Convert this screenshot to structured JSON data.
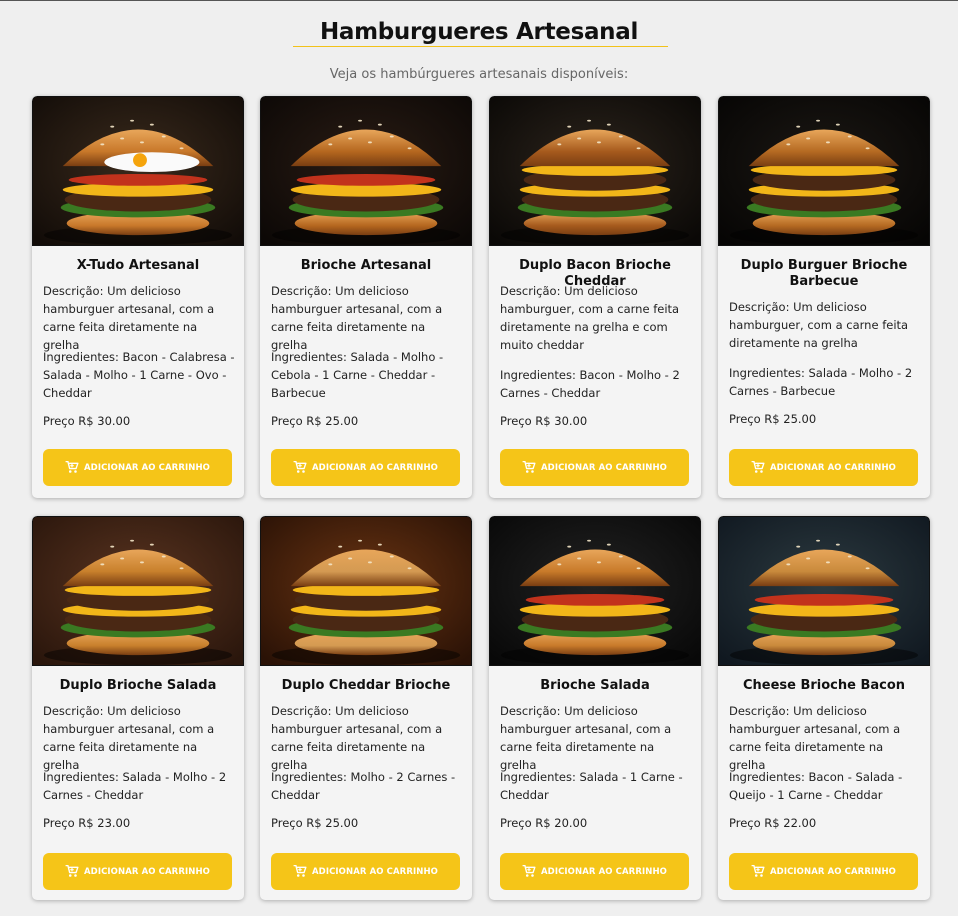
{
  "page": {
    "title": "Hamburgueres Artesanal",
    "subtitle": "Veja os hambúrgueres artesanais disponíveis:"
  },
  "colors": {
    "accent": "#f5c518",
    "card_bg": "#f4f4f4",
    "page_bg": "#efefef"
  },
  "products": [
    {
      "name": "X-Tudo Artesanal",
      "description": "Descrição: Um delicioso hamburguer artesanal, com a carne feita diretamente na grelha",
      "ingredients": "Ingredientes: Bacon - Calabresa - Salada - Molho - 1 Carne - Ovo - Cheddar",
      "price": "Preço R$ 30.00",
      "button": "ADICIONAR AO CARRINHO",
      "icon": "cart-icon",
      "image": "burger-egg-photo"
    },
    {
      "name": "Brioche Artesanal",
      "description": "Descrição: Um delicioso hamburguer artesanal, com a carne feita diretamente na grelha",
      "ingredients": "Ingredientes: Salada - Molho - Cebola - 1 Carne - Cheddar - Barbecue",
      "price": "Preço R$ 25.00",
      "button": "ADICIONAR AO CARRINHO",
      "icon": "cart-icon",
      "image": "burger-brioche-photo"
    },
    {
      "name": "Duplo Bacon Brioche Cheddar",
      "description": "Descrição: Um delicioso hamburguer, com a carne feita diretamente na grelha e com muito cheddar",
      "ingredients": "Ingredientes: Bacon - Molho - 2 Carnes - Cheddar",
      "price": "Preço R$ 30.00",
      "button": "ADICIONAR AO CARRINHO",
      "icon": "cart-icon",
      "image": "burger-bacon-cheddar-photo"
    },
    {
      "name": "Duplo Burguer Brioche Barbecue",
      "description": "Descrição: Um delicioso hamburguer, com a carne feita diretamente na grelha",
      "ingredients": "Ingredientes: Salada - Molho - 2 Carnes - Barbecue",
      "price": "Preço R$ 25.00",
      "button": "ADICIONAR AO CARRINHO",
      "icon": "cart-icon",
      "image": "burger-barbecue-photo"
    },
    {
      "name": "Duplo Brioche Salada",
      "description": "Descrição: Um delicioso hamburguer artesanal, com a carne feita diretamente na grelha",
      "ingredients": "Ingredientes: Salada - Molho - 2 Carnes - Cheddar",
      "price": "Preço R$ 23.00",
      "button": "ADICIONAR AO CARRINHO",
      "icon": "cart-icon",
      "image": "burger-salad-photo"
    },
    {
      "name": "Duplo Cheddar Brioche",
      "description": "Descrição: Um delicioso hamburguer artesanal, com a carne feita diretamente na grelha",
      "ingredients": "Ingredientes: Molho - 2 Carnes - Cheddar",
      "price": "Preço R$ 25.00",
      "button": "ADICIONAR AO CARRINHO",
      "icon": "cart-icon",
      "image": "burger-double-cheddar-photo"
    },
    {
      "name": "Brioche Salada",
      "description": "Descrição: Um delicioso hamburguer artesanal, com a carne feita diretamente na grelha",
      "ingredients": "Ingredientes: Salada - 1 Carne - Cheddar",
      "price": "Preço R$ 20.00",
      "button": "ADICIONAR AO CARRINHO",
      "icon": "cart-icon",
      "image": "burger-fries-photo"
    },
    {
      "name": "Cheese Brioche Bacon",
      "description": "Descrição: Um delicioso hamburguer artesanal, com a carne feita diretamente na grelha",
      "ingredients": "Ingredientes: Bacon - Salada - Queijo - 1 Carne - Cheddar",
      "price": "Preço R$ 22.00",
      "button": "ADICIONAR AO CARRINHO",
      "icon": "cart-icon",
      "image": "burger-cheese-bacon-photo"
    }
  ]
}
